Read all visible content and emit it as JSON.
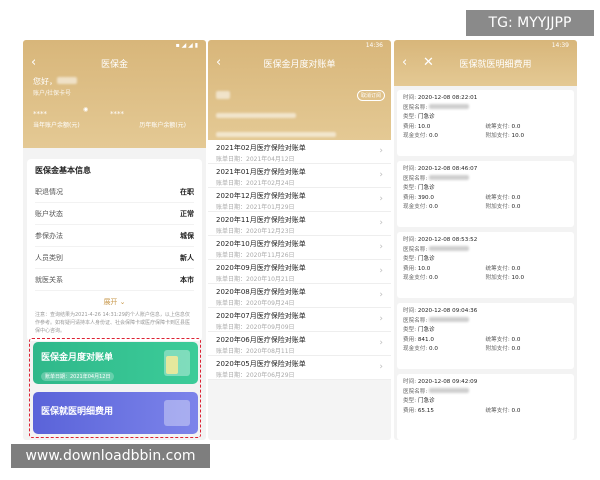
{
  "watermark_top": "TG: MYYJJPP",
  "watermark_bottom": "www.downloadbbin.com",
  "status_time_1": "",
  "status_time_2": "14:36",
  "status_time_3": "14:39",
  "screen1": {
    "title": "医保金",
    "greeting": "您好，",
    "card_label": "账户/社保卡号",
    "masked_1": "****",
    "masked_2": "****",
    "label_left": "当年账户余额(元)",
    "label_right": "历年账户余额(元)",
    "section_title": "医保金基本信息",
    "rows": [
      {
        "k": "职退情况",
        "v": "在职"
      },
      {
        "k": "账户状态",
        "v": "正常"
      },
      {
        "k": "参保办法",
        "v": "城保"
      },
      {
        "k": "人员类别",
        "v": "新人"
      },
      {
        "k": "就医关系",
        "v": "本市"
      }
    ],
    "expand": "展开",
    "note": "注意：查询结果为2021-4-26 14:31:29的个人账户信息，以上信息仅作参考。如有疑问请持本人身份证、社会保障卡或医疗保障卡到区县医保中心咨询。",
    "card_monthly": {
      "title": "医保金月度对账单",
      "date": "账单日期：2021年04月12日"
    },
    "card_detail": {
      "title": "医保就医明细费用"
    }
  },
  "screen2": {
    "title": "医保金月度对账单",
    "badge": "取消订阅",
    "items": [
      {
        "title": "2021年02月医疗保险对账单",
        "date": "账单日期：2021年04月12日"
      },
      {
        "title": "2021年01月医疗保险对账单",
        "date": "账单日期：2021年02月24日"
      },
      {
        "title": "2020年12月医疗保险对账单",
        "date": "账单日期：2021年01月29日"
      },
      {
        "title": "2020年11月医疗保险对账单",
        "date": "账单日期：2020年12月23日"
      },
      {
        "title": "2020年10月医疗保险对账单",
        "date": "账单日期：2020年11月26日"
      },
      {
        "title": "2020年09月医疗保险对账单",
        "date": "账单日期：2020年10月21日"
      },
      {
        "title": "2020年08月医疗保险对账单",
        "date": "账单日期：2020年09月24日"
      },
      {
        "title": "2020年07月医疗保险对账单",
        "date": "账单日期：2020年09月09日"
      },
      {
        "title": "2020年06月医疗保险对账单",
        "date": "账单日期：2020年08月11日"
      },
      {
        "title": "2020年05月医疗保险对账单",
        "date": "账单日期：2020年06月29日"
      }
    ]
  },
  "screen3": {
    "title": "医保就医明细费用",
    "labels": {
      "time": "时间: ",
      "hospital": "医院名称: ",
      "type": "类型: ",
      "fee": "费用: ",
      "pooled": "统筹支付: ",
      "cash": "现金支付: ",
      "additional": "附加支付: "
    },
    "records": [
      {
        "time": "2020-12-08 08:22:01",
        "type": "门急诊",
        "fee": "10.0",
        "pooled": "0.0",
        "cash": "0.0",
        "additional": "10.0"
      },
      {
        "time": "2020-12-08 08:46:07",
        "type": "门急诊",
        "fee": "390.0",
        "pooled": "0.0",
        "cash": "0.0",
        "additional": "0.0"
      },
      {
        "time": "2020-12-08 08:53:52",
        "type": "门急诊",
        "fee": "10.0",
        "pooled": "0.0",
        "cash": "0.0",
        "additional": "10.0"
      },
      {
        "time": "2020-12-08 09:04:36",
        "type": "门急诊",
        "fee": "841.0",
        "pooled": "0.0",
        "cash": "0.0",
        "additional": "0.0"
      },
      {
        "time": "2020-12-08 09:42:09",
        "type": "门急诊",
        "fee": "65.15",
        "pooled": "0.0",
        "cash": "",
        "additional": ""
      }
    ]
  }
}
